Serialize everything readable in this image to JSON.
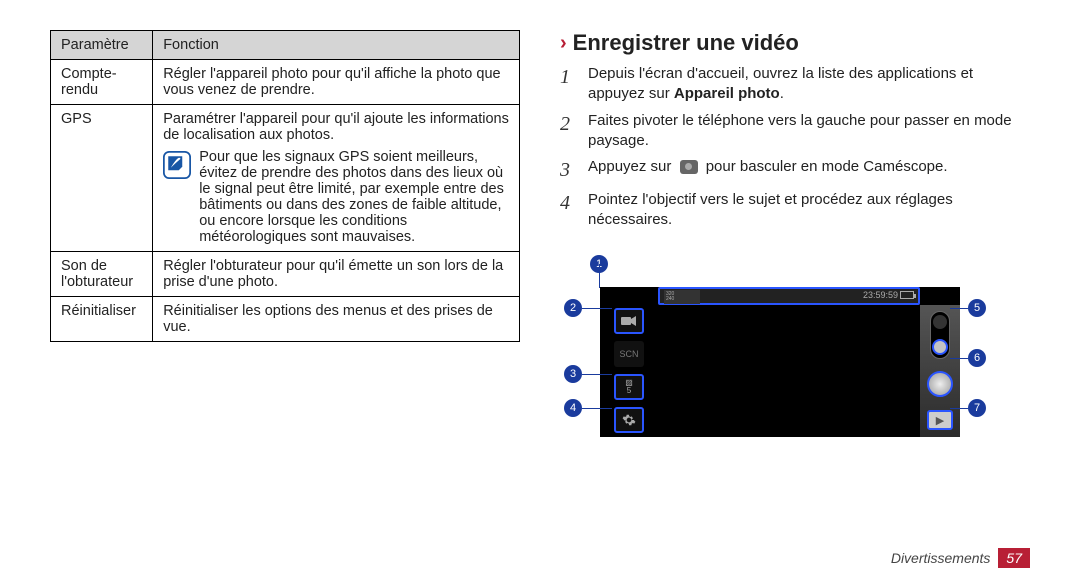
{
  "table": {
    "headers": {
      "param": "Paramètre",
      "func": "Fonction"
    },
    "rows": {
      "compte_rendu": {
        "param": "Compte-rendu",
        "func": "Régler l'appareil photo pour qu'il affiche la photo que vous venez de prendre."
      },
      "gps": {
        "param": "GPS",
        "func_top": "Paramétrer l'appareil pour qu'il ajoute les informations de localisation aux photos.",
        "tip": "Pour que les signaux GPS soient meilleurs, évitez de prendre des photos dans des lieux où le signal peut être limité, par exemple entre des bâtiments ou dans des zones de faible altitude, ou encore lorsque les conditions météorologiques sont mauvaises."
      },
      "son": {
        "param": "Son de l'obturateur",
        "func": "Régler l'obturateur pour qu'il émette un son lors de la prise d'une photo."
      },
      "reinit": {
        "param": "Réinitialiser",
        "func": "Réinitialiser les options des menus et des prises de vue."
      }
    }
  },
  "section": {
    "title": "Enregistrer une vidéo",
    "steps": {
      "s1a": "Depuis l'écran d'accueil, ouvrez la liste des applications et appuyez sur ",
      "s1b": "Appareil photo",
      "s1c": ".",
      "s2": "Faites pivoter le téléphone vers la gauche pour passer en mode paysage.",
      "s3a": "Appuyez sur ",
      "s3b": " pour basculer en mode Caméscope.",
      "s4": "Pointez l'objectif vers le sujet et procédez aux réglages nécessaires."
    }
  },
  "camera_ui": {
    "resolution_top": "320",
    "resolution_bottom": "240",
    "time": "23:59:59",
    "exposure_label": "5",
    "scene_mode": "SCN",
    "callouts": {
      "c1": "1",
      "c2": "2",
      "c3": "3",
      "c4": "4",
      "c5": "5",
      "c6": "6",
      "c7": "7"
    }
  },
  "footer": {
    "section": "Divertissements",
    "page": "57"
  }
}
